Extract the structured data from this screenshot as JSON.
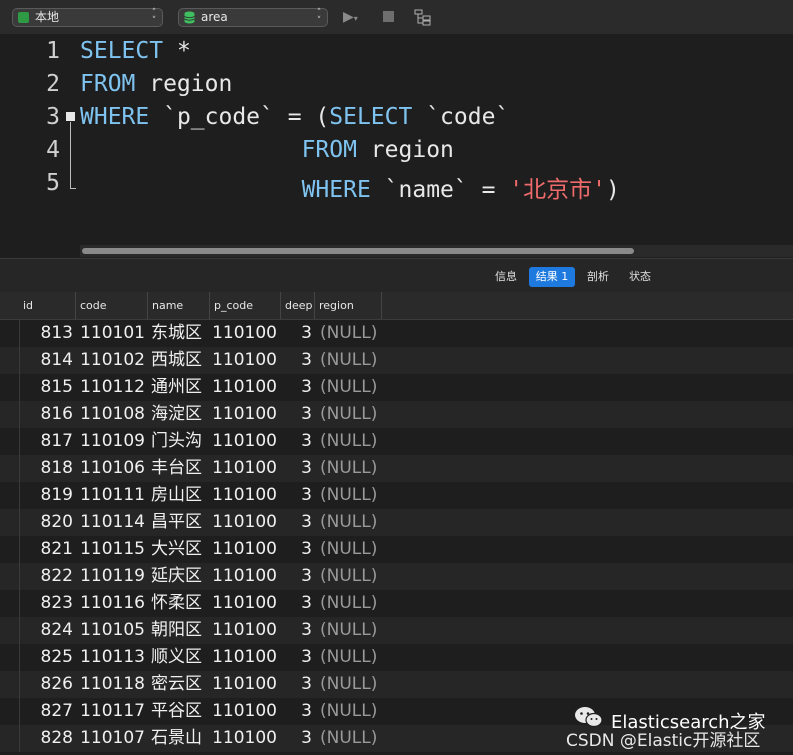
{
  "toolbar": {
    "connection": "本地",
    "database": "area",
    "run_icon": "play-icon",
    "stop_icon": "stop-icon",
    "explain_icon": "explain-tree-icon"
  },
  "editor": {
    "line_numbers": [
      "1",
      "2",
      "3",
      "4",
      "5"
    ]
  },
  "result_tabs": {
    "info": "信息",
    "result1": "结果 1",
    "profile": "剖析",
    "status": "状态"
  },
  "grid": {
    "columns": [
      "id",
      "code",
      "name",
      "p_code",
      "deep",
      "region"
    ],
    "rows": [
      {
        "id": "813",
        "code": "110101",
        "name": "东城区",
        "p_code": "110100",
        "deep": "3",
        "region": "(NULL)"
      },
      {
        "id": "814",
        "code": "110102",
        "name": "西城区",
        "p_code": "110100",
        "deep": "3",
        "region": "(NULL)"
      },
      {
        "id": "815",
        "code": "110112",
        "name": "通州区",
        "p_code": "110100",
        "deep": "3",
        "region": "(NULL)"
      },
      {
        "id": "816",
        "code": "110108",
        "name": "海淀区",
        "p_code": "110100",
        "deep": "3",
        "region": "(NULL)"
      },
      {
        "id": "817",
        "code": "110109",
        "name": "门头沟",
        "p_code": "110100",
        "deep": "3",
        "region": "(NULL)"
      },
      {
        "id": "818",
        "code": "110106",
        "name": "丰台区",
        "p_code": "110100",
        "deep": "3",
        "region": "(NULL)"
      },
      {
        "id": "819",
        "code": "110111",
        "name": "房山区",
        "p_code": "110100",
        "deep": "3",
        "region": "(NULL)"
      },
      {
        "id": "820",
        "code": "110114",
        "name": "昌平区",
        "p_code": "110100",
        "deep": "3",
        "region": "(NULL)"
      },
      {
        "id": "821",
        "code": "110115",
        "name": "大兴区",
        "p_code": "110100",
        "deep": "3",
        "region": "(NULL)"
      },
      {
        "id": "822",
        "code": "110119",
        "name": "延庆区",
        "p_code": "110100",
        "deep": "3",
        "region": "(NULL)"
      },
      {
        "id": "823",
        "code": "110116",
        "name": "怀柔区",
        "p_code": "110100",
        "deep": "3",
        "region": "(NULL)"
      },
      {
        "id": "824",
        "code": "110105",
        "name": "朝阳区",
        "p_code": "110100",
        "deep": "3",
        "region": "(NULL)"
      },
      {
        "id": "825",
        "code": "110113",
        "name": "顺义区",
        "p_code": "110100",
        "deep": "3",
        "region": "(NULL)"
      },
      {
        "id": "826",
        "code": "110118",
        "name": "密云区",
        "p_code": "110100",
        "deep": "3",
        "region": "(NULL)"
      },
      {
        "id": "827",
        "code": "110117",
        "name": "平谷区",
        "p_code": "110100",
        "deep": "3",
        "region": "(NULL)"
      },
      {
        "id": "828",
        "code": "110107",
        "name": "石景山",
        "p_code": "110100",
        "deep": "3",
        "region": "(NULL)"
      }
    ]
  },
  "watermark": {
    "title": "Elasticsearch之家",
    "byline": "CSDN @Elastic开源社区"
  }
}
